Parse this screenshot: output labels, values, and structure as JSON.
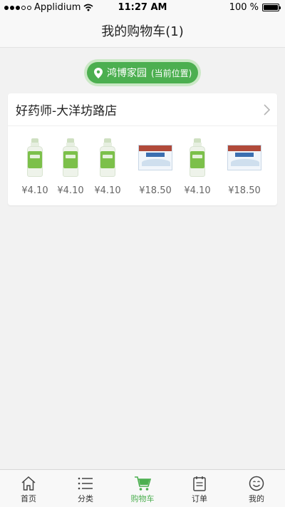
{
  "status_bar": {
    "carrier": "Applidium",
    "time": "11:27 AM",
    "battery_text": "100 %"
  },
  "header": {
    "title": "我的购物车(1)"
  },
  "location": {
    "name": "鸿博家园",
    "suffix": "(当前位置)"
  },
  "store": {
    "name": "好药师-大洋坊路店",
    "products": [
      {
        "kind": "bottle",
        "price": "¥4.10"
      },
      {
        "kind": "bottle",
        "price": "¥4.10"
      },
      {
        "kind": "bottle",
        "price": "¥4.10"
      },
      {
        "kind": "box",
        "price": "¥18.50"
      },
      {
        "kind": "bottle",
        "price": "¥4.10"
      },
      {
        "kind": "box",
        "price": "¥18.50"
      }
    ]
  },
  "tabbar": {
    "items": [
      {
        "label": "首页",
        "icon": "home-icon"
      },
      {
        "label": "分类",
        "icon": "list-icon"
      },
      {
        "label": "购物车",
        "icon": "cart-icon"
      },
      {
        "label": "订单",
        "icon": "order-icon"
      },
      {
        "label": "我的",
        "icon": "smile-icon"
      }
    ],
    "active_index": 2
  },
  "colors": {
    "accent": "#4caf50",
    "accent_glow": "#cbe8c6"
  }
}
